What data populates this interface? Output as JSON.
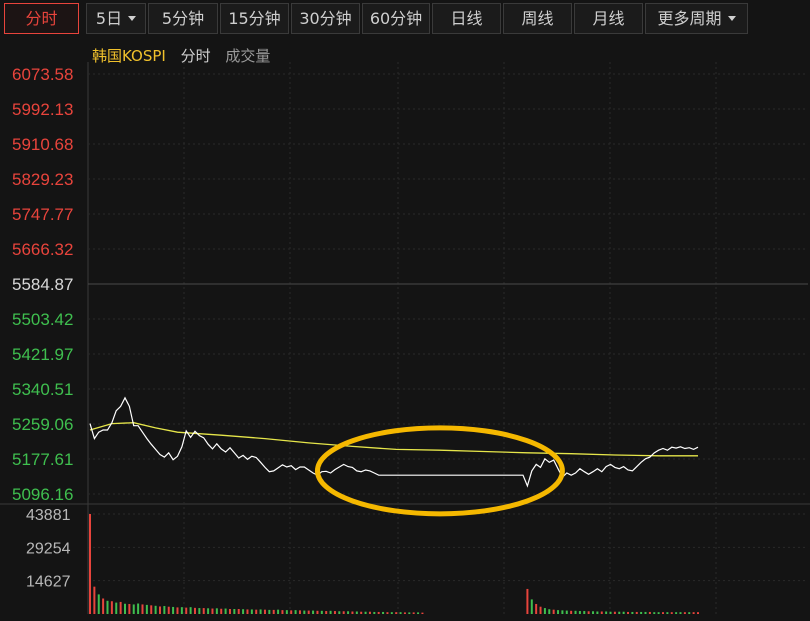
{
  "tabs": [
    {
      "label": "分时",
      "active": true,
      "dropdown": false
    },
    {
      "label": "5日",
      "active": false,
      "dropdown": true
    },
    {
      "label": "5分钟",
      "active": false,
      "dropdown": false
    },
    {
      "label": "15分钟",
      "active": false,
      "dropdown": false
    },
    {
      "label": "30分钟",
      "active": false,
      "dropdown": false
    },
    {
      "label": "60分钟",
      "active": false,
      "dropdown": false
    },
    {
      "label": "日线",
      "active": false,
      "dropdown": false
    },
    {
      "label": "周线",
      "active": false,
      "dropdown": false
    },
    {
      "label": "月线",
      "active": false,
      "dropdown": false
    },
    {
      "label": "更多周期",
      "active": false,
      "dropdown": true
    }
  ],
  "legend": {
    "index_name": "韩国KOSPI",
    "mode": "分时",
    "volume_label": "成交量"
  },
  "colors": {
    "up": "#e8443c",
    "down": "#3fbf4f",
    "neutral": "#d8d8d8",
    "price_line": "#ffffff",
    "avg_line": "#e6e64a",
    "highlight": "#f5b800",
    "grid": "#2a2a2a"
  },
  "chart_data": {
    "type": "line",
    "series_price_label": "",
    "y_ticks": [
      "6073.58",
      "5992.13",
      "5910.68",
      "5829.23",
      "5747.77",
      "5666.32",
      "5584.87",
      "5503.42",
      "5421.97",
      "5340.51",
      "5259.06",
      "5177.61",
      "5096.16"
    ],
    "y_reference": 5584.87,
    "ylim": [
      5096.16,
      6073.58
    ],
    "price": [
      [
        0,
        5260
      ],
      [
        1,
        5225
      ],
      [
        2,
        5240
      ],
      [
        3,
        5245
      ],
      [
        4,
        5245
      ],
      [
        5,
        5262
      ],
      [
        6,
        5290
      ],
      [
        7,
        5300
      ],
      [
        8,
        5320
      ],
      [
        9,
        5300
      ],
      [
        10,
        5255
      ],
      [
        11,
        5255
      ],
      [
        12,
        5240
      ],
      [
        13,
        5225
      ],
      [
        14,
        5212
      ],
      [
        15,
        5200
      ],
      [
        16,
        5188
      ],
      [
        17,
        5182
      ],
      [
        18,
        5192
      ],
      [
        19,
        5176
      ],
      [
        20,
        5184
      ],
      [
        21,
        5206
      ],
      [
        22,
        5243
      ],
      [
        23,
        5228
      ],
      [
        24,
        5242
      ],
      [
        25,
        5232
      ],
      [
        26,
        5227
      ],
      [
        27,
        5212
      ],
      [
        28,
        5201
      ],
      [
        29,
        5213
      ],
      [
        30,
        5201
      ],
      [
        31,
        5194
      ],
      [
        32,
        5204
      ],
      [
        33,
        5192
      ],
      [
        34,
        5180
      ],
      [
        35,
        5186
      ],
      [
        36,
        5177
      ],
      [
        37,
        5184
      ],
      [
        38,
        5181
      ],
      [
        39,
        5170
      ],
      [
        40,
        5158
      ],
      [
        41,
        5148
      ],
      [
        42,
        5150
      ],
      [
        43,
        5157
      ],
      [
        44,
        5164
      ],
      [
        45,
        5159
      ],
      [
        46,
        5162
      ],
      [
        47,
        5153
      ],
      [
        48,
        5159
      ],
      [
        49,
        5159
      ],
      [
        50,
        5152
      ],
      [
        51,
        5145
      ],
      [
        52,
        5140
      ],
      [
        53,
        5148
      ],
      [
        54,
        5149
      ],
      [
        55,
        5145
      ],
      [
        56,
        5153
      ],
      [
        57,
        5159
      ],
      [
        58,
        5165
      ],
      [
        59,
        5160
      ],
      [
        60,
        5158
      ],
      [
        61,
        5150
      ],
      [
        62,
        5148
      ],
      [
        63,
        5152
      ],
      [
        64,
        5150
      ],
      [
        65,
        5145
      ],
      [
        66,
        5140
      ],
      [
        67,
        5140
      ],
      [
        68,
        5140
      ],
      [
        69,
        5140
      ],
      [
        70,
        5140
      ],
      [
        71,
        5140
      ],
      [
        72,
        5140
      ],
      [
        73,
        5140
      ],
      [
        74,
        5140
      ],
      [
        75,
        5140
      ],
      [
        76,
        5140
      ],
      [
        77,
        5140
      ],
      [
        78,
        5140
      ],
      [
        79,
        5140
      ],
      [
        80,
        5140
      ],
      [
        81,
        5140
      ],
      [
        82,
        5140
      ],
      [
        83,
        5140
      ],
      [
        84,
        5140
      ],
      [
        85,
        5140
      ],
      [
        86,
        5140
      ],
      [
        87,
        5140
      ],
      [
        88,
        5140
      ],
      [
        89,
        5140
      ],
      [
        90,
        5140
      ],
      [
        91,
        5140
      ],
      [
        92,
        5140
      ],
      [
        93,
        5140
      ],
      [
        94,
        5140
      ],
      [
        95,
        5140
      ],
      [
        96,
        5140
      ],
      [
        97,
        5140
      ],
      [
        98,
        5140
      ],
      [
        99,
        5140
      ],
      [
        100,
        5115
      ],
      [
        101,
        5150
      ],
      [
        102,
        5165
      ],
      [
        103,
        5158
      ],
      [
        104,
        5178
      ],
      [
        105,
        5170
      ],
      [
        106,
        5175
      ],
      [
        107,
        5155
      ],
      [
        108,
        5135
      ],
      [
        109,
        5145
      ],
      [
        110,
        5140
      ],
      [
        111,
        5145
      ],
      [
        112,
        5155
      ],
      [
        113,
        5148
      ],
      [
        114,
        5142
      ],
      [
        115,
        5148
      ],
      [
        116,
        5155
      ],
      [
        117,
        5148
      ],
      [
        118,
        5160
      ],
      [
        119,
        5165
      ],
      [
        120,
        5158
      ],
      [
        121,
        5155
      ],
      [
        122,
        5160
      ],
      [
        123,
        5152
      ],
      [
        124,
        5150
      ],
      [
        125,
        5160
      ],
      [
        126,
        5170
      ],
      [
        127,
        5178
      ],
      [
        128,
        5182
      ],
      [
        129,
        5192
      ],
      [
        130,
        5198
      ],
      [
        131,
        5202
      ],
      [
        132,
        5198
      ],
      [
        133,
        5205
      ],
      [
        134,
        5203
      ],
      [
        135,
        5206
      ],
      [
        136,
        5202
      ],
      [
        137,
        5204
      ],
      [
        138,
        5200
      ],
      [
        139,
        5205
      ]
    ],
    "average": [
      [
        0,
        5245
      ],
      [
        5,
        5260
      ],
      [
        10,
        5262
      ],
      [
        15,
        5250
      ],
      [
        20,
        5240
      ],
      [
        30,
        5233
      ],
      [
        40,
        5225
      ],
      [
        50,
        5215
      ],
      [
        60,
        5207
      ],
      [
        70,
        5200
      ],
      [
        80,
        5198
      ],
      [
        90,
        5195
      ],
      [
        100,
        5192
      ],
      [
        110,
        5190
      ],
      [
        120,
        5187
      ],
      [
        130,
        5185
      ],
      [
        139,
        5185
      ]
    ],
    "x_points": 140,
    "volume_ticks": [
      "43881",
      "29254",
      "14627"
    ],
    "volume_max": 43881,
    "volume": [
      43881,
      12000,
      8600,
      6800,
      5800,
      5600,
      5000,
      5300,
      4500,
      4400,
      4200,
      4600,
      4200,
      4000,
      3800,
      3600,
      3300,
      3500,
      3200,
      3100,
      2900,
      3000,
      2800,
      3000,
      2700,
      2600,
      2600,
      2500,
      2400,
      2500,
      2300,
      2400,
      2200,
      2200,
      2200,
      2100,
      2000,
      2000,
      1900,
      2000,
      1900,
      1800,
      1800,
      1900,
      1700,
      1700,
      1600,
      1700,
      1600,
      1500,
      1500,
      1500,
      1400,
      1400,
      1300,
      1400,
      1300,
      1200,
      1200,
      1200,
      1100,
      1100,
      1000,
      1000,
      1000,
      900,
      900,
      900,
      800,
      800,
      800,
      800,
      700,
      700,
      700,
      700,
      600,
      600,
      600,
      600,
      600,
      600,
      500,
      500,
      500,
      500,
      500,
      500,
      500,
      500,
      500,
      500,
      500,
      500,
      500,
      500,
      500,
      500,
      500,
      500,
      11000,
      6400,
      4400,
      3200,
      2600,
      2100,
      1900,
      1700,
      1600,
      1500,
      1400,
      1400,
      1300,
      1300,
      1200,
      1200,
      1100,
      1100,
      1100,
      1000,
      1000,
      1000,
      1000,
      900,
      900,
      900,
      900,
      900,
      900,
      800,
      800,
      800,
      800,
      800,
      800,
      800,
      800,
      800,
      800,
      800
    ],
    "volume_gap": [
      77,
      99
    ],
    "volume_colors": [
      "up",
      "up",
      "down",
      "up",
      "down",
      "up",
      "down",
      "up",
      "down",
      "up",
      "down",
      "down",
      "up",
      "down",
      "up",
      "down",
      "up",
      "down",
      "up",
      "down",
      "up",
      "down",
      "up",
      "down",
      "up",
      "down",
      "up",
      "down",
      "up",
      "down",
      "up",
      "down",
      "up",
      "down",
      "up",
      "down",
      "up",
      "down",
      "up",
      "down",
      "up",
      "down",
      "up",
      "down",
      "up",
      "down",
      "up",
      "down",
      "up",
      "down",
      "up",
      "down",
      "up",
      "down",
      "up",
      "down",
      "up",
      "down",
      "up",
      "down",
      "up",
      "down",
      "up",
      "down",
      "up",
      "down",
      "up",
      "down",
      "up",
      "down",
      "up",
      "down",
      "up",
      "down",
      "up",
      "down",
      "up",
      "down",
      "up",
      "down",
      "up",
      "down",
      "up",
      "down",
      "up",
      "down",
      "up",
      "down",
      "up",
      "down",
      "up",
      "down",
      "up",
      "down",
      "up",
      "down",
      "up",
      "down",
      "up",
      "down",
      "up",
      "down",
      "up",
      "up",
      "down",
      "down",
      "up",
      "down",
      "down",
      "down",
      "up",
      "down",
      "down",
      "down",
      "up",
      "down",
      "down",
      "up",
      "down",
      "down",
      "up",
      "down",
      "down",
      "up",
      "down",
      "up",
      "down",
      "down",
      "up",
      "down",
      "down",
      "up",
      "down",
      "up",
      "down",
      "down",
      "up",
      "down",
      "up",
      "up"
    ],
    "highlight_ellipse": {
      "x_start": 52,
      "x_end": 108,
      "y_top": 5250,
      "y_bottom": 5050
    }
  }
}
